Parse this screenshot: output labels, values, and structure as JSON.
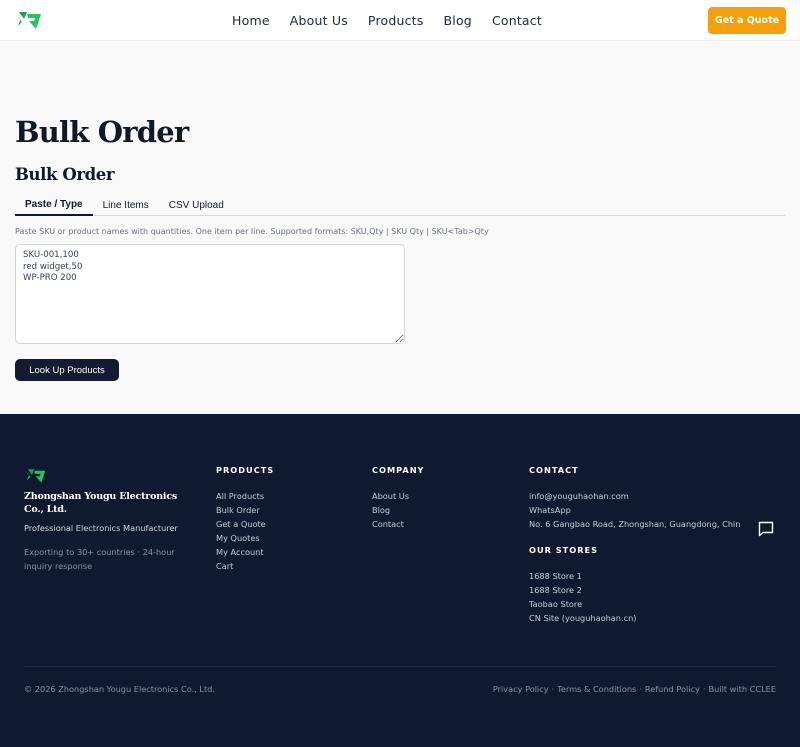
{
  "brand": {
    "accent": "#f5a00b",
    "logo_green": "#22c55e",
    "dark": "#0f1a30"
  },
  "header": {
    "nav": [
      "Home",
      "About Us",
      "Products",
      "Blog",
      "Contact"
    ],
    "cta_label": "Get a Quote"
  },
  "main": {
    "page_title": "Bulk Order",
    "section_title": "Bulk Order",
    "tabs": [
      "Paste / Type",
      "Line Items",
      "CSV Upload"
    ],
    "active_tab": "Paste / Type",
    "hint": "Paste SKU or product names with quantities. One item per line. Supported formats: SKU,Qty | SKU Qty | SKU<Tab>Qty",
    "textarea_value": "SKU-001,100\nred widget,50\nWP-PRO 200",
    "lookup_label": "Look Up Products"
  },
  "footer": {
    "company_name": "Zhongshan Yougu Electronics Co., Ltd.",
    "tagline": "Professional Electronics Manufacturer",
    "description": "Exporting to 30+ countries · 24-hour inquiry response",
    "products": {
      "heading": "PRODUCTS",
      "links": [
        "All Products",
        "Bulk Order",
        "Get a Quote",
        "My Quotes",
        "My Account",
        "Cart"
      ]
    },
    "company": {
      "heading": "COMPANY",
      "links": [
        "About Us",
        "Blog",
        "Contact"
      ]
    },
    "contact": {
      "heading": "CONTACT",
      "email": "info@youguhaohan.com",
      "whatsapp": "WhatsApp",
      "address": "No. 6 Gangbao Road, Zhongshan, Guangdong, Chin"
    },
    "stores": {
      "heading": "OUR STORES",
      "links": [
        "1688 Store 1",
        "1688 Store 2",
        "Taobao Store",
        "CN Site (youguhaohan.cn)"
      ]
    },
    "copyright": "© 2026 Zhongshan Yougu Electronics Co., Ltd.",
    "legal": {
      "privacy": "Privacy Policy",
      "terms": "Terms & Conditions",
      "refund": "Refund Policy",
      "built": "Built with CCLEE",
      "separator": "·"
    },
    "chat_icon": "chat-bubble-icon"
  }
}
